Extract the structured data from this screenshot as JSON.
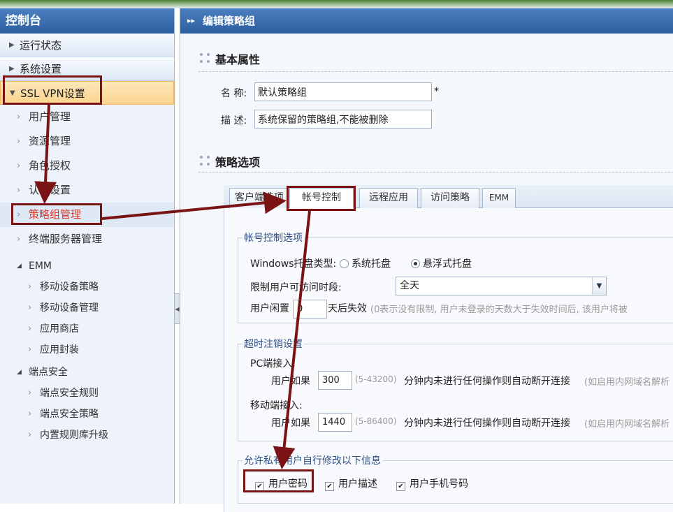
{
  "sidebar": {
    "title": "控制台",
    "sections": [
      {
        "label": "运行状态"
      },
      {
        "label": "系统设置"
      },
      {
        "label": "SSL VPN设置"
      }
    ],
    "items": [
      {
        "label": "用户管理"
      },
      {
        "label": "资源管理"
      },
      {
        "label": "角色授权"
      },
      {
        "label": "认证设置"
      },
      {
        "label": "策略组管理"
      },
      {
        "label": "终端服务器管理"
      }
    ],
    "groups": [
      {
        "label": "EMM",
        "children": [
          "移动设备策略",
          "移动设备管理",
          "应用商店",
          "应用封装"
        ]
      },
      {
        "label": "端点安全",
        "children": [
          "端点安全规则",
          "端点安全策略",
          "内置规则库升级"
        ]
      }
    ]
  },
  "main": {
    "header": "编辑策略组",
    "basic": {
      "title": "基本属性",
      "name_label": "名 称:",
      "name_value": "默认策略组",
      "required_mark": "*",
      "desc_label": "描 述:",
      "desc_value": "系统保留的策略组,不能被删除"
    },
    "policy": {
      "title": "策略选项",
      "tabs": [
        "客户端选项",
        "帐号控制",
        "远程应用",
        "访问策略",
        "EMM"
      ],
      "account": {
        "legend": "帐号控制选项",
        "tray_label": "Windows托盘类型:",
        "tray_options": [
          "系统托盘",
          "悬浮式托盘"
        ],
        "time_label": "限制用户可访问时段:",
        "time_value": "全天",
        "idle_prefix": "用户闲置",
        "idle_value": "0",
        "idle_suffix": "天后失效",
        "idle_hint": "(0表示没有限制, 用户未登录的天数大于失效时间后, 该用户将被"
      },
      "timeout": {
        "legend": "超时注销设置",
        "pc_label": "PC端接入:",
        "pc_prefix": "用户如果",
        "pc_value": "300",
        "pc_range": "(5-43200)",
        "pc_text": "分钟内未进行任何操作则自动断开连接",
        "pc_hint": "(如启用内网域名解析",
        "mobile_label": "移动端接入:",
        "mobile_prefix": "用户如果",
        "mobile_value": "1440",
        "mobile_range": "(5-86400)",
        "mobile_text": "分钟内未进行任何操作则自动断开连接",
        "mobile_hint": "(如启用内网域名解析"
      },
      "allow": {
        "legend": "允许私有用户自行修改以下信息",
        "options": [
          "用户密码",
          "用户描述",
          "用户手机号码"
        ]
      }
    }
  },
  "colors": {
    "header_blue": "#2b5f9f",
    "annotation": "#7a1414",
    "selected_text": "#d9362b"
  }
}
